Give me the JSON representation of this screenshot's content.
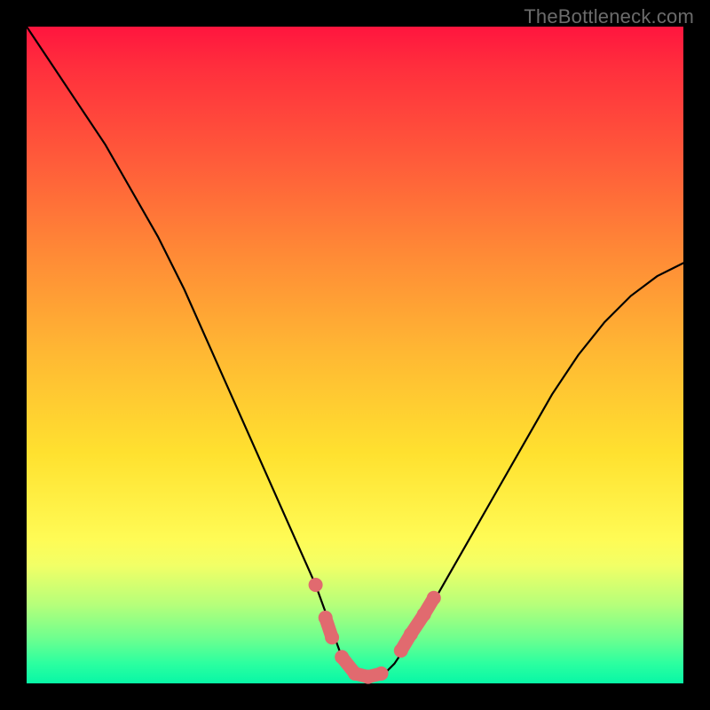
{
  "attribution": "TheBottleneck.com",
  "colors": {
    "gradient_top": "#ff153e",
    "gradient_bottom": "#08f7a6",
    "curve": "#000000",
    "marker": "#e16a6f",
    "frame": "#000000"
  },
  "chart_data": {
    "type": "line",
    "title": "",
    "xlabel": "",
    "ylabel": "",
    "xlim": [
      0,
      100
    ],
    "ylim": [
      0,
      100
    ],
    "grid": false,
    "legend": false,
    "series": [
      {
        "name": "bottleneck-curve",
        "x": [
          0,
          4,
          8,
          12,
          16,
          20,
          24,
          28,
          32,
          36,
          40,
          44,
          48,
          50,
          52,
          54,
          56,
          60,
          64,
          68,
          72,
          76,
          80,
          84,
          88,
          92,
          96,
          100
        ],
        "y": [
          100,
          94,
          88,
          82,
          75,
          68,
          60,
          51,
          42,
          33,
          24,
          15,
          4,
          1,
          1,
          1,
          3,
          9,
          16,
          23,
          30,
          37,
          44,
          50,
          55,
          59,
          62,
          64
        ]
      }
    ],
    "markers": [
      {
        "x": 44.0,
        "y": 15.0
      },
      {
        "x": 45.5,
        "y": 10.0
      },
      {
        "x": 46.5,
        "y": 7.0
      },
      {
        "x": 48.0,
        "y": 4.0
      },
      {
        "x": 50.0,
        "y": 1.5
      },
      {
        "x": 52.0,
        "y": 1.0
      },
      {
        "x": 54.0,
        "y": 1.5
      },
      {
        "x": 57.0,
        "y": 5.0
      },
      {
        "x": 58.5,
        "y": 7.5
      },
      {
        "x": 60.5,
        "y": 10.5
      },
      {
        "x": 62.0,
        "y": 13.0
      }
    ]
  }
}
